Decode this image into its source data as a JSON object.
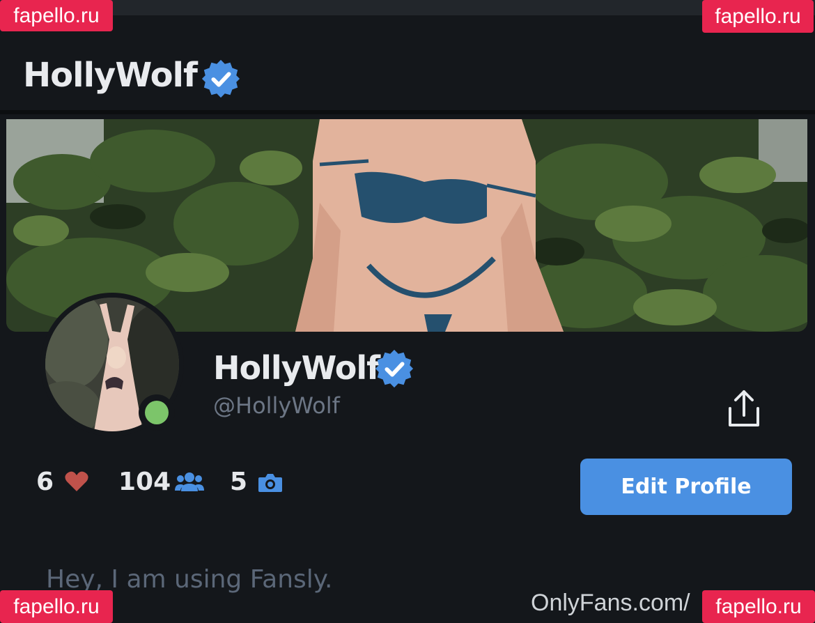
{
  "header": {
    "title": "HollyWolf"
  },
  "profile": {
    "display_name": "HollyWolf",
    "handle": "@HollyWolf",
    "bio": "Hey, I am using Fansly.",
    "status": "online"
  },
  "stats": {
    "likes": "6",
    "subscribers": "104",
    "media": "5"
  },
  "actions": {
    "edit_profile_label": "Edit Profile"
  },
  "icons": {
    "verified": "verified-badge-icon",
    "share": "share-icon",
    "likes": "heart-icon",
    "subscribers": "users-icon",
    "media": "camera-icon"
  },
  "watermarks": {
    "top_left": "fapello.ru",
    "top_right": "fapello.ru",
    "bottom_left": "fapello.ru",
    "bottom_right": "fapello.ru",
    "footer": "OnlyFans.com/"
  },
  "colors": {
    "background": "#14171b",
    "accent": "#4a90e2",
    "online": "#7cc56a",
    "heart": "#c0524b",
    "watermark": "#e8254f"
  }
}
